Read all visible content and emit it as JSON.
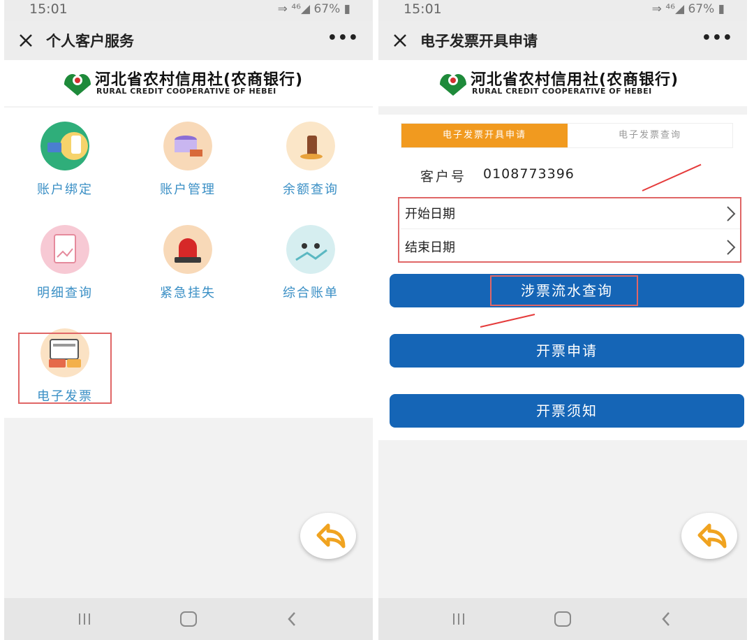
{
  "colors": {
    "accent_orange": "#f19a1f",
    "button_blue": "#1565b6",
    "label_blue": "#3a8fc5",
    "highlight_red": "#e06666"
  },
  "left": {
    "status": {
      "time": "15:01",
      "battery": "67%"
    },
    "title": "个人客户服务",
    "brand": {
      "cn": "河北省农村信用社(农商银行)",
      "en": "RURAL CREDIT COOPERATIVE OF HEBEI"
    },
    "tiles": [
      {
        "label": "账户绑定",
        "icon": "account-bind-icon"
      },
      {
        "label": "账户管理",
        "icon": "account-manage-icon"
      },
      {
        "label": "余额查询",
        "icon": "balance-query-icon"
      },
      {
        "label": "明细查询",
        "icon": "detail-query-icon"
      },
      {
        "label": "紧急挂失",
        "icon": "emergency-loss-icon"
      },
      {
        "label": "综合账单",
        "icon": "statement-icon"
      },
      {
        "label": "电子发票",
        "icon": "e-invoice-icon"
      }
    ]
  },
  "right": {
    "status": {
      "time": "15:01",
      "battery": "67%"
    },
    "title": "电子发票开具申请",
    "brand": {
      "cn": "河北省农村信用社(农商银行)",
      "en": "RURAL CREDIT COOPERATIVE OF HEBEI"
    },
    "tabs": [
      "电子发票开具申请",
      "电子发票查询"
    ],
    "customer": {
      "label": "客户号",
      "value": "0108773396"
    },
    "start_date": "开始日期",
    "end_date": "结束日期",
    "buttons": {
      "query": "涉票流水查询",
      "apply": "开票申请",
      "notice": "开票须知"
    }
  }
}
